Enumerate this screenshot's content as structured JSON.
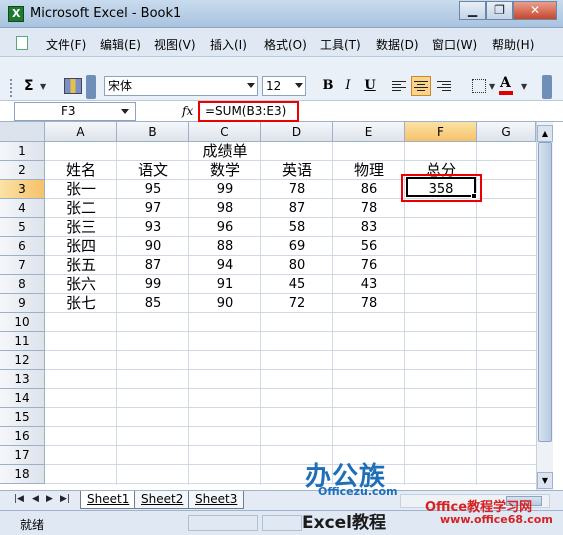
{
  "window": {
    "title": "Microsoft Excel - Book1",
    "minimize": "▁",
    "restore": "❐",
    "close": "✕"
  },
  "menu": {
    "items": [
      "文件(F)",
      "编辑(E)",
      "视图(V)",
      "插入(I)",
      "格式(O)",
      "工具(T)",
      "数据(D)",
      "窗口(W)",
      "帮助(H)"
    ]
  },
  "toolbar": {
    "sigma": "Σ",
    "font_name": "宋体",
    "font_size": "12",
    "bold": "B",
    "italic": "I",
    "underline": "U",
    "font_color_letter": "A",
    "font_color": "#e00000",
    "align_active": "center"
  },
  "formula_bar": {
    "name_box": "F3",
    "fx": "fx",
    "formula": "=SUM(B3:E3)"
  },
  "grid": {
    "columns": [
      "A",
      "B",
      "C",
      "D",
      "E",
      "F",
      "G"
    ],
    "rows": [
      "1",
      "2",
      "3",
      "4",
      "5",
      "6",
      "7",
      "8",
      "9",
      "10",
      "11",
      "12",
      "13",
      "14",
      "15",
      "16",
      "17",
      "18"
    ],
    "selected_cell": "F3",
    "title": "成绩单",
    "headers": [
      "姓名",
      "语文",
      "数学",
      "英语",
      "物理",
      "总分"
    ],
    "records": [
      {
        "name": "张一",
        "chinese": "95",
        "math": "99",
        "english": "78",
        "physics": "86",
        "total": "358"
      },
      {
        "name": "张二",
        "chinese": "97",
        "math": "98",
        "english": "87",
        "physics": "78",
        "total": ""
      },
      {
        "name": "张三",
        "chinese": "93",
        "math": "96",
        "english": "58",
        "physics": "83",
        "total": ""
      },
      {
        "name": "张四",
        "chinese": "90",
        "math": "88",
        "english": "69",
        "physics": "56",
        "total": ""
      },
      {
        "name": "张五",
        "chinese": "87",
        "math": "94",
        "english": "80",
        "physics": "76",
        "total": ""
      },
      {
        "name": "张六",
        "chinese": "99",
        "math": "91",
        "english": "45",
        "physics": "43",
        "total": ""
      },
      {
        "name": "张七",
        "chinese": "85",
        "math": "90",
        "english": "72",
        "physics": "78",
        "total": ""
      }
    ]
  },
  "sheets": {
    "tabs": [
      "Sheet1",
      "Sheet2",
      "Sheet3"
    ],
    "active": "Sheet1"
  },
  "status": {
    "text": "就绪"
  },
  "watermarks": {
    "bangong": "办公族",
    "officezu": "Officezu.com",
    "excel_tutorial": "Excel教程",
    "office_tutorial": "Office教程学习网",
    "office_url": "www.office68.com"
  },
  "colors": {
    "highlight_red": "#e00000",
    "selected_header": "#f6c26a",
    "watermark_blue": "#1f6fb8",
    "watermark_red": "#d62222"
  }
}
